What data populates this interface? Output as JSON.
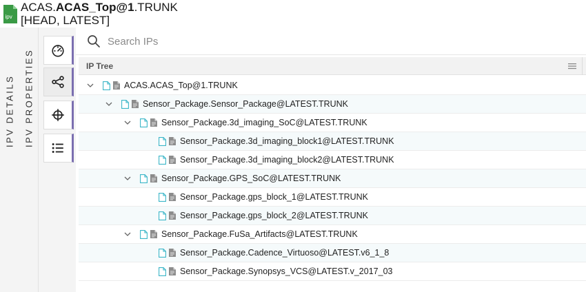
{
  "header": {
    "logo_text": "ipv",
    "title_prefix": "ACAS.",
    "title_bold": "ACAS_Top@1",
    "title_suffix": ".TRUNK",
    "subtitle": "[HEAD, LATEST]"
  },
  "vertical_tabs": [
    {
      "label": "IPV DETAILS"
    },
    {
      "label": "IPV PROPERTIES"
    }
  ],
  "rail_buttons": [
    {
      "icon": "gauge-icon",
      "active": false
    },
    {
      "icon": "share-icon",
      "active": true
    },
    {
      "icon": "crosshair-icon",
      "active": false
    },
    {
      "icon": "list-icon",
      "active": false
    }
  ],
  "search": {
    "placeholder": "Search IPs",
    "value": ""
  },
  "tree": {
    "header_label": "IP Tree",
    "rows": [
      {
        "label": "ACAS.ACAS_Top@1.TRUNK",
        "level": 0,
        "expanded": true
      },
      {
        "label": "Sensor_Package.Sensor_Package@LATEST.TRUNK",
        "level": 1,
        "expanded": true
      },
      {
        "label": "Sensor_Package.3d_imaging_SoC@LATEST.TRUNK",
        "level": 2,
        "expanded": true
      },
      {
        "label": "Sensor_Package.3d_imaging_block1@LATEST.TRUNK",
        "level": 3,
        "expanded": false
      },
      {
        "label": "Sensor_Package.3d_imaging_block2@LATEST.TRUNK",
        "level": 3,
        "expanded": false
      },
      {
        "label": "Sensor_Package.GPS_SoC@LATEST.TRUNK",
        "level": 2,
        "expanded": true
      },
      {
        "label": "Sensor_Package.gps_block_1@LATEST.TRUNK",
        "level": 3,
        "expanded": false
      },
      {
        "label": "Sensor_Package.gps_block_2@LATEST.TRUNK",
        "level": 3,
        "expanded": false
      },
      {
        "label": "Sensor_Package.FuSa_Artifacts@LATEST.TRUNK",
        "level": 2,
        "expanded": true
      },
      {
        "label": "Sensor_Package.Cadence_Virtuoso@LATEST.v6_1_8",
        "level": 3,
        "expanded": false
      },
      {
        "label": "Sensor_Package.Synopsys_VCS@LATEST.v_2017_03",
        "level": 3,
        "expanded": false
      }
    ]
  },
  "colors": {
    "brand_green": "#3a9a45",
    "accent_purple": "#7b6fb0",
    "file_icon_teal": "#3bb6c8",
    "doc_icon_grey": "#8c8c8c"
  }
}
